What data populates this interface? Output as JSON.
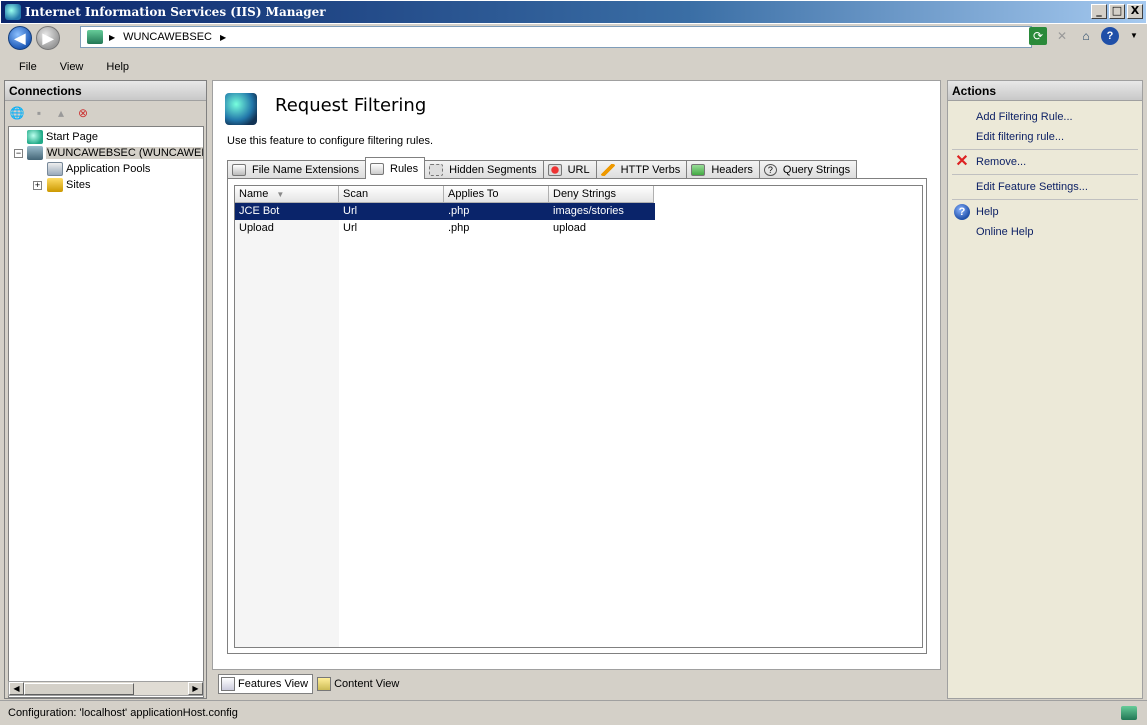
{
  "window": {
    "title": "Internet Information Services (IIS) Manager",
    "minimize": "_",
    "maximize": "□",
    "close": "X"
  },
  "address": {
    "crumbs": [
      "WUNCAWEBSEC"
    ],
    "help_glyph": "?"
  },
  "menu": [
    "File",
    "View",
    "Help"
  ],
  "connections": {
    "header": "Connections",
    "tree": [
      {
        "label": "Start Page"
      },
      {
        "label": "WUNCAWEBSEC (WUNCAWEBSEC\\"
      },
      {
        "label": "Application Pools"
      },
      {
        "label": "Sites"
      }
    ]
  },
  "feature": {
    "title": "Request Filtering",
    "description": "Use this feature to configure filtering rules.",
    "tabs": [
      {
        "label": "File Name Extensions"
      },
      {
        "label": "Rules"
      },
      {
        "label": "Hidden Segments"
      },
      {
        "label": "URL"
      },
      {
        "label": "HTTP Verbs"
      },
      {
        "label": "Headers"
      },
      {
        "label": "Query Strings"
      }
    ],
    "active_tab": "Rules",
    "columns": [
      "Name",
      "Scan",
      "Applies To",
      "Deny Strings"
    ],
    "rows": [
      {
        "name": "JCE Bot",
        "scan": "Url",
        "applies_to": ".php",
        "deny": "images/stories"
      },
      {
        "name": "Upload",
        "scan": "Url",
        "applies_to": ".php",
        "deny": "upload"
      }
    ],
    "selected_row": 0
  },
  "views": {
    "features": "Features View",
    "content": "Content View"
  },
  "actions": {
    "header": "Actions",
    "add_rule": "Add Filtering Rule...",
    "edit_rule": "Edit filtering rule...",
    "remove": "Remove...",
    "edit_settings": "Edit Feature Settings...",
    "help": "Help",
    "online_help": "Online Help"
  },
  "status": {
    "text": "Configuration: 'localhost' applicationHost.config"
  },
  "colors": {
    "selection": "#0a246a",
    "title_gradient_start": "#0a246a",
    "action_link": "#0b1f64"
  }
}
